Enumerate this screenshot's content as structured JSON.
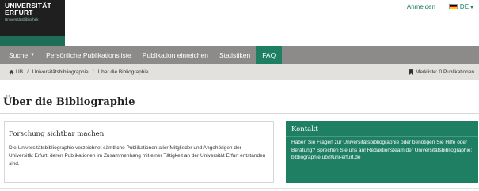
{
  "header": {
    "logo_line1": "UNIVERSITÄT",
    "logo_line2": "ERFURT",
    "logo_line3": "Universitätsbibliothek",
    "login_label": "Anmelden",
    "language_label": "DE"
  },
  "nav": {
    "items": [
      {
        "label": "Suche",
        "has_dropdown": true
      },
      {
        "label": "Persönliche Publikationsliste"
      },
      {
        "label": "Publikation einreichen"
      },
      {
        "label": "Statistiken"
      },
      {
        "label": "FAQ",
        "active": true
      }
    ]
  },
  "breadcrumb": {
    "items": [
      "UB",
      "Universitätsbibliographie",
      "Über die Bibliographie"
    ],
    "merkliste_label": "Merkliste:",
    "merkliste_count": "0 Publikationen"
  },
  "page": {
    "title": "Über die Bibliographie"
  },
  "card_left": {
    "title": "Forschung sichtbar machen",
    "text": "Die Universitätsbibliographie verzeichnet sämtliche Publikationen aller Mitglieder und Angehörigen der Universität Erfurt, deren Publikationen im Zusammenhang mit einer Tätigkeit an der Universität Erfurt entstanden sind."
  },
  "card_right": {
    "title": "Kontakt",
    "text": "Haben Sie Fragen zur Universitätsbibliographie oder benötigen Sie Hilfe oder Beratung? Sprechen Sie uns an! Redaktionsteam der Universitätsbibliographie:",
    "email": "bibliographie.ub@uni-erfurt.de"
  },
  "colors": {
    "accent_green": "#1e7f63",
    "nav_gray": "#8c8b8a",
    "breadcrumb_bg": "#e3e1de"
  },
  "icons": [
    "home-icon",
    "bookmark-icon",
    "flag-de-icon",
    "caret-down-icon"
  ]
}
